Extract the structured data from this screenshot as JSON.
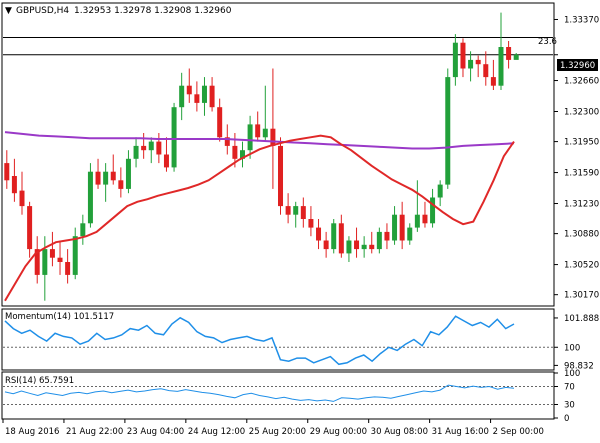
{
  "header": {
    "symbol": "GBPUSD,H4",
    "quote": "1.32953 1.32978 1.32908 1.32960",
    "expand_glyph": "▼"
  },
  "fib_label": "23.6",
  "colors": {
    "bull": "#22a03a",
    "bear": "#e02020",
    "sma_fast": "#e02828",
    "sma_slow": "#9a39c8",
    "osc": "#1f8fe8",
    "level": "#666666"
  },
  "chart_data": [
    {
      "type": "candlestick",
      "title": "GBPUSD,H4",
      "ylim": [
        1.3005,
        1.3355
      ],
      "y_ticks": [
        "1.33370",
        "1.32960",
        "1.32660",
        "1.32300",
        "1.31950",
        "1.31590",
        "1.31230",
        "1.30880",
        "1.30520",
        "1.30170"
      ],
      "x_tick_labels": [
        "18 Aug 2016",
        "21 Aug 22:00",
        "23 Aug 04:00",
        "24 Aug 12:00",
        "25 Aug 20:00",
        "29 Aug 00:00",
        "30 Aug 08:00",
        "31 Aug 16:00",
        "2 Sep 00:00"
      ],
      "current_price": "1.32960",
      "fib_level": {
        "label": "23.6",
        "value": 1.3316
      },
      "candles": [
        [
          1.317,
          1.3185,
          1.314,
          1.315
        ],
        [
          1.3155,
          1.3175,
          1.3125,
          1.3135
        ],
        [
          1.3138,
          1.316,
          1.311,
          1.312
        ],
        [
          1.312,
          1.3125,
          1.306,
          1.307
        ],
        [
          1.307,
          1.3085,
          1.303,
          1.304
        ],
        [
          1.304,
          1.3085,
          1.301,
          1.307
        ],
        [
          1.307,
          1.309,
          1.305,
          1.306
        ],
        [
          1.306,
          1.308,
          1.304,
          1.3055
        ],
        [
          1.3055,
          1.307,
          1.303,
          1.304
        ],
        [
          1.304,
          1.3095,
          1.3035,
          1.3085
        ],
        [
          1.3085,
          1.311,
          1.3075,
          1.31
        ],
        [
          1.31,
          1.317,
          1.3095,
          1.316
        ],
        [
          1.316,
          1.3175,
          1.314,
          1.3145
        ],
        [
          1.3145,
          1.317,
          1.3125,
          1.316
        ],
        [
          1.316,
          1.318,
          1.3145,
          1.315
        ],
        [
          1.315,
          1.3165,
          1.313,
          1.314
        ],
        [
          1.314,
          1.3185,
          1.3135,
          1.3175
        ],
        [
          1.3175,
          1.32,
          1.3165,
          1.319
        ],
        [
          1.319,
          1.3205,
          1.3175,
          1.3185
        ],
        [
          1.3185,
          1.32,
          1.317,
          1.3195
        ],
        [
          1.3195,
          1.3205,
          1.317,
          1.318
        ],
        [
          1.318,
          1.32,
          1.316,
          1.3165
        ],
        [
          1.3165,
          1.324,
          1.316,
          1.3235
        ],
        [
          1.3235,
          1.3275,
          1.322,
          1.326
        ],
        [
          1.326,
          1.328,
          1.324,
          1.325
        ],
        [
          1.325,
          1.3265,
          1.323,
          1.324
        ],
        [
          1.324,
          1.327,
          1.3225,
          1.326
        ],
        [
          1.326,
          1.327,
          1.323,
          1.3235
        ],
        [
          1.3235,
          1.3245,
          1.3195,
          1.32
        ],
        [
          1.32,
          1.3215,
          1.318,
          1.319
        ],
        [
          1.319,
          1.3205,
          1.3165,
          1.3175
        ],
        [
          1.3175,
          1.3195,
          1.3165,
          1.3185
        ],
        [
          1.3185,
          1.3225,
          1.3175,
          1.3215
        ],
        [
          1.3215,
          1.323,
          1.3195,
          1.32
        ],
        [
          1.32,
          1.326,
          1.3195,
          1.321
        ],
        [
          1.321,
          1.328,
          1.314,
          1.319
        ],
        [
          1.319,
          1.32,
          1.311,
          1.312
        ],
        [
          1.312,
          1.3135,
          1.31,
          1.311
        ],
        [
          1.311,
          1.3125,
          1.3095,
          1.312
        ],
        [
          1.312,
          1.313,
          1.3095,
          1.3105
        ],
        [
          1.3105,
          1.312,
          1.3085,
          1.3095
        ],
        [
          1.3095,
          1.3105,
          1.307,
          1.308
        ],
        [
          1.308,
          1.309,
          1.306,
          1.307
        ],
        [
          1.307,
          1.3105,
          1.3065,
          1.31
        ],
        [
          1.31,
          1.311,
          1.306,
          1.3065
        ],
        [
          1.3065,
          1.3085,
          1.3055,
          1.308
        ],
        [
          1.308,
          1.3095,
          1.306,
          1.307
        ],
        [
          1.307,
          1.3085,
          1.306,
          1.3075
        ],
        [
          1.3075,
          1.309,
          1.3065,
          1.307
        ],
        [
          1.307,
          1.3095,
          1.3065,
          1.309
        ],
        [
          1.309,
          1.31,
          1.307,
          1.308
        ],
        [
          1.308,
          1.312,
          1.3075,
          1.311
        ],
        [
          1.311,
          1.3125,
          1.307,
          1.308
        ],
        [
          1.308,
          1.31,
          1.3075,
          1.3095
        ],
        [
          1.3095,
          1.315,
          1.309,
          1.311
        ],
        [
          1.311,
          1.3125,
          1.3095,
          1.31
        ],
        [
          1.31,
          1.314,
          1.3095,
          1.313
        ],
        [
          1.313,
          1.315,
          1.312,
          1.3145
        ],
        [
          1.3145,
          1.328,
          1.314,
          1.327
        ],
        [
          1.327,
          1.332,
          1.326,
          1.331
        ],
        [
          1.331,
          1.3315,
          1.327,
          1.328
        ],
        [
          1.328,
          1.33,
          1.3265,
          1.329
        ],
        [
          1.329,
          1.3295,
          1.327,
          1.3285
        ],
        [
          1.3285,
          1.33,
          1.326,
          1.327
        ],
        [
          1.327,
          1.329,
          1.3255,
          1.326
        ],
        [
          1.326,
          1.3345,
          1.3255,
          1.3305
        ],
        [
          1.3305,
          1.3312,
          1.328,
          1.329
        ],
        [
          1.329,
          1.3298,
          1.3291,
          1.3296
        ]
      ],
      "sma_fast": [
        1.301,
        1.303,
        1.305,
        1.3065,
        1.3072,
        1.3078,
        1.308,
        1.3082,
        1.3085,
        1.309,
        1.31,
        1.311,
        1.312,
        1.3125,
        1.3128,
        1.3132,
        1.3135,
        1.3138,
        1.3141,
        1.3145,
        1.315,
        1.3158,
        1.3166,
        1.3174,
        1.318,
        1.3186,
        1.319,
        1.3193,
        1.3196,
        1.3198,
        1.32,
        1.3202,
        1.32,
        1.3192,
        1.3185,
        1.3176,
        1.3167,
        1.3159,
        1.3151,
        1.3145,
        1.3139,
        1.3131,
        1.3122,
        1.3113,
        1.3105,
        1.3099,
        1.3102,
        1.3125,
        1.315,
        1.3178,
        1.3195
      ],
      "sma_slow": [
        1.3206,
        1.3204,
        1.3202,
        1.3201,
        1.32,
        1.3199,
        1.3199,
        1.3199,
        1.3199,
        1.3198,
        1.3198,
        1.3198,
        1.3198,
        1.3198,
        1.3197,
        1.3196,
        1.3195,
        1.3194,
        1.3193,
        1.3192,
        1.3191,
        1.319,
        1.3189,
        1.3188,
        1.3187,
        1.3187,
        1.3188,
        1.319,
        1.3191,
        1.3192,
        1.3193
      ],
      "xlabel": "",
      "ylabel": ""
    },
    {
      "type": "line",
      "title": "Momentum(14) 101.5117",
      "y_ticks": [
        "101.888",
        "100",
        "98.832"
      ],
      "reference_level": 100,
      "ylim": [
        98.6,
        102.4
      ],
      "values": [
        101.7,
        101.2,
        100.9,
        101.1,
        100.7,
        100.4,
        100.9,
        100.7,
        100.6,
        100.2,
        100.4,
        100.9,
        100.5,
        100.6,
        100.8,
        101.2,
        101.1,
        101.4,
        100.9,
        100.8,
        101.5,
        101.9,
        101.6,
        101.0,
        100.7,
        100.6,
        100.3,
        100.5,
        100.6,
        100.7,
        100.5,
        100.4,
        100.6,
        99.2,
        99.1,
        99.3,
        99.3,
        99.0,
        99.2,
        99.4,
        98.9,
        99.0,
        99.3,
        99.5,
        99.1,
        99.6,
        100.0,
        99.8,
        100.2,
        100.5,
        100.1,
        101.0,
        100.8,
        101.3,
        102.0,
        101.7,
        101.4,
        101.6,
        101.3,
        101.8,
        101.2,
        101.5
      ]
    },
    {
      "type": "line",
      "title": "RSI(14) 65.7591",
      "y_ticks": [
        "100",
        "70",
        "30",
        "0"
      ],
      "reference_levels": [
        70,
        30
      ],
      "ylim": [
        0,
        100
      ],
      "values": [
        58,
        54,
        60,
        55,
        50,
        56,
        53,
        50,
        55,
        57,
        54,
        58,
        60,
        56,
        59,
        62,
        58,
        60,
        63,
        65,
        61,
        59,
        63,
        60,
        57,
        55,
        52,
        48,
        45,
        52,
        55,
        50,
        47,
        43,
        46,
        42,
        39,
        41,
        38,
        40,
        37,
        45,
        44,
        42,
        45,
        47,
        46,
        44,
        48,
        52,
        56,
        60,
        58,
        62,
        73,
        70,
        67,
        71,
        68,
        70,
        64,
        68,
        66
      ]
    }
  ]
}
